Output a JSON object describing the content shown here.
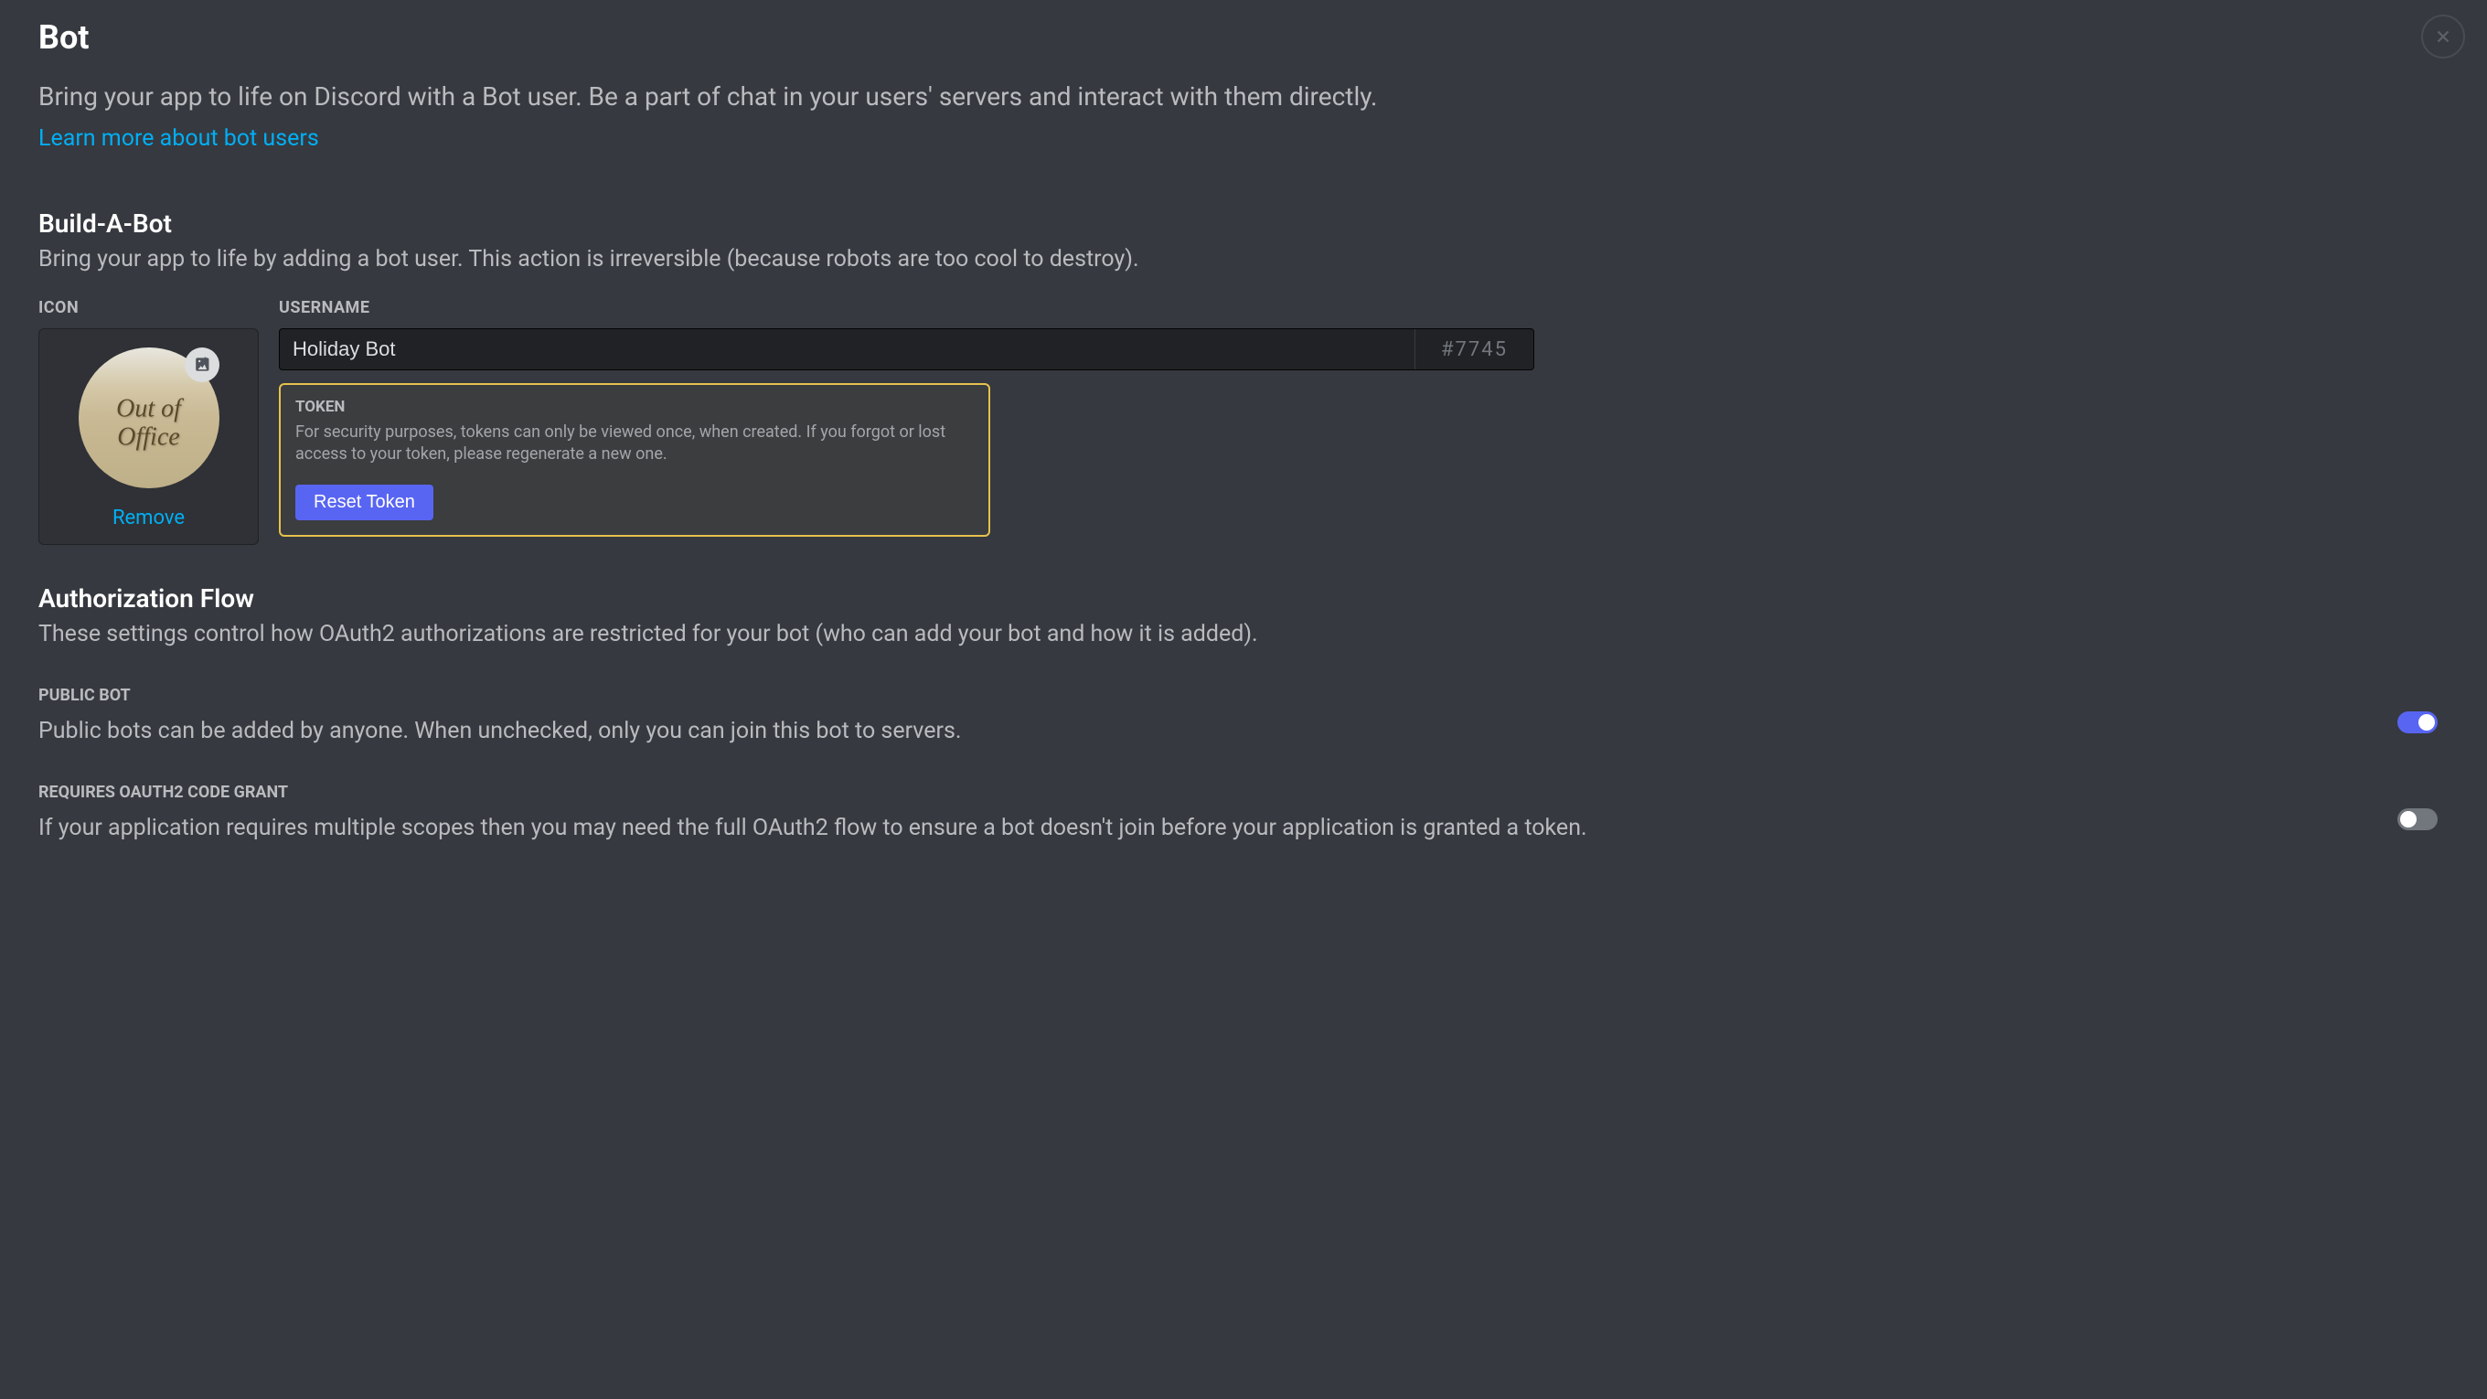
{
  "page": {
    "title": "Bot",
    "subtitle": "Bring your app to life on Discord with a Bot user. Be a part of chat in your users' servers and interact with them directly.",
    "learn_more": "Learn more about bot users"
  },
  "build_a_bot": {
    "title": "Build-A-Bot",
    "description": "Bring your app to life by adding a bot user. This action is irreversible (because robots are too cool to destroy).",
    "icon_label": "ICON",
    "avatar_text": "Out of Office",
    "remove_label": "Remove",
    "username_label": "USERNAME",
    "username_value": "Holiday Bot",
    "discriminator": "#7745"
  },
  "token": {
    "label": "TOKEN",
    "description": "For security purposes, tokens can only be viewed once, when created. If you forgot or lost access to your token, please regenerate a new one.",
    "reset_button": "Reset Token"
  },
  "authorization": {
    "title": "Authorization Flow",
    "description": "These settings control how OAuth2 authorizations are restricted for your bot (who can add your bot and how it is added)."
  },
  "public_bot": {
    "label": "PUBLIC BOT",
    "description": "Public bots can be added by anyone. When unchecked, only you can join this bot to servers.",
    "enabled": true
  },
  "oauth_grant": {
    "label": "REQUIRES OAUTH2 CODE GRANT",
    "description": "If your application requires multiple scopes then you may need the full OAuth2 flow to ensure a bot doesn't join before your application is granted a token.",
    "enabled": false
  }
}
